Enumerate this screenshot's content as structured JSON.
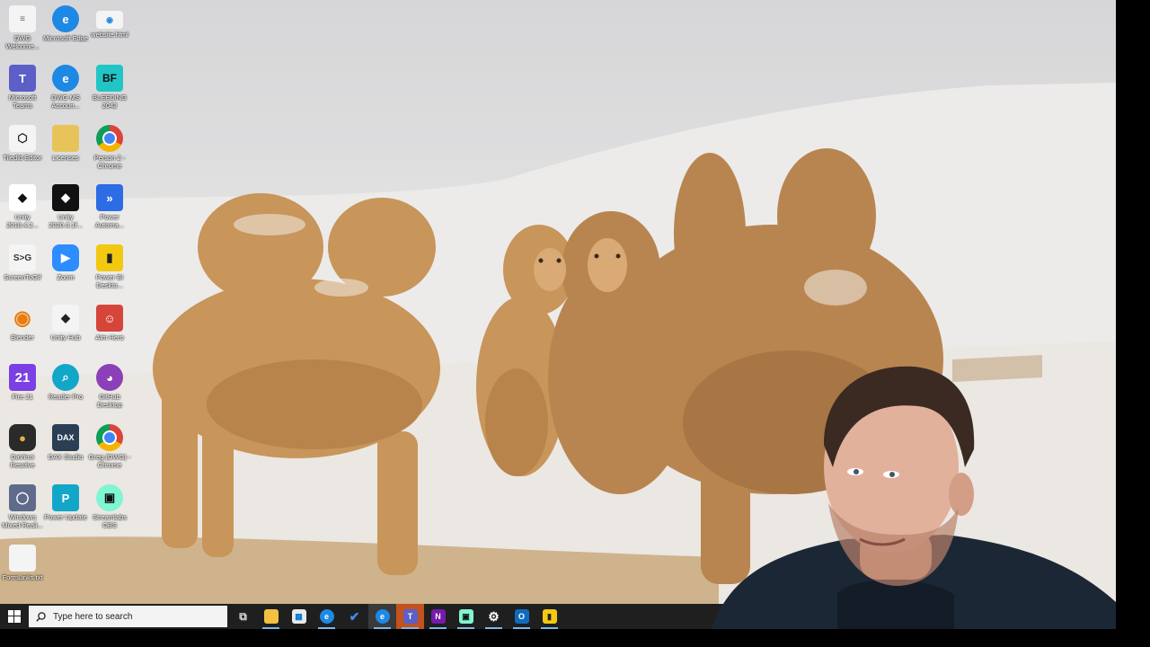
{
  "desktop": {
    "icons": [
      {
        "label": "DWG Welcome...",
        "icon": "document-icon",
        "color": "#f4f4f4"
      },
      {
        "label": "Microsoft Edge",
        "icon": "edge-icon",
        "color": "#1e88e5"
      },
      {
        "label": "website.html",
        "icon": "html-file-icon",
        "color": "#f4f4f4"
      },
      {
        "label": "Microsoft Teams",
        "icon": "teams-icon",
        "color": "#5b5fc7"
      },
      {
        "label": "DWG MS Accoun...",
        "icon": "edge-profile-icon",
        "color": "#1e88e5"
      },
      {
        "label": "BLEEDING 2042",
        "icon": "game-icon",
        "color": "#22c5c5"
      },
      {
        "label": "Tiledld Editor",
        "icon": "tiled-icon",
        "color": "#2b2b2b"
      },
      {
        "label": "Licenses",
        "icon": "folder-zip-icon",
        "color": "#e7c45a"
      },
      {
        "label": "Person 2 - Chrome",
        "icon": "chrome-icon",
        "color": "#db4437"
      },
      {
        "label": "Unity 2018.4.2...",
        "icon": "unity-icon",
        "color": "#111111"
      },
      {
        "label": "Unity 2020.3.1f...",
        "icon": "unity-dark-icon",
        "color": "#111111"
      },
      {
        "label": "Power Automa...",
        "icon": "power-automate-icon",
        "color": "#2d6ce5"
      },
      {
        "label": "ScreenToGif",
        "icon": "screentogif-icon",
        "color": "#f4f4f4"
      },
      {
        "label": "Zoom",
        "icon": "zoom-icon",
        "color": "#2d8cff"
      },
      {
        "label": "Power BI Deskto...",
        "icon": "power-bi-icon",
        "color": "#f2c811"
      },
      {
        "label": "Blender",
        "icon": "blender-icon",
        "color": "#e87d0d"
      },
      {
        "label": "Unity Hub",
        "icon": "unity-hub-icon",
        "color": "#f4f4f4"
      },
      {
        "label": "Aim Hero",
        "icon": "aim-hero-icon",
        "color": "#d6453a"
      },
      {
        "label": "Fire 21",
        "icon": "fire-21-icon",
        "color": "#7b3fe4"
      },
      {
        "label": "Reader Pro",
        "icon": "magnifier-icon",
        "color": "#12a7c9"
      },
      {
        "label": "GitHub Desktop",
        "icon": "github-icon",
        "color": "#8b3fb8"
      },
      {
        "label": "DaVinci Resolve",
        "icon": "davinci-icon",
        "color": "#2a2a2a"
      },
      {
        "label": "DAX Studio",
        "icon": "dax-studio-icon",
        "color": "#2a3f54"
      },
      {
        "label": "Greg (DWG) - Chrome",
        "icon": "chrome-profile-icon",
        "color": "#db4437"
      },
      {
        "label": "Windows Mixed Reali...",
        "icon": "mixed-reality-icon",
        "color": "#5f6b8a"
      },
      {
        "label": "Power Update",
        "icon": "power-update-icon",
        "color": "#12a7c9"
      },
      {
        "label": "Streamlabs OBS",
        "icon": "streamlabs-icon",
        "color": "#80f5d2"
      },
      {
        "label": "FormLinks.txt",
        "icon": "text-file-icon",
        "color": "#f4f4f4"
      }
    ]
  },
  "taskbar": {
    "search_placeholder": "Type here to search",
    "apps": [
      {
        "name": "task-view",
        "icon": "task-view-icon",
        "color": "#1f1f1f",
        "glyph": "⧉"
      },
      {
        "name": "file-explorer",
        "icon": "folder-icon",
        "color": "#f3c03f",
        "glyph": ""
      },
      {
        "name": "store",
        "icon": "store-icon",
        "color": "#e9e9e9",
        "glyph": ""
      },
      {
        "name": "edge",
        "icon": "edge-icon",
        "color": "#1e88e5",
        "glyph": ""
      },
      {
        "name": "todo",
        "icon": "checkmark-icon",
        "color": "#1f1f1f",
        "glyph": "✔"
      },
      {
        "name": "edge-profile",
        "icon": "edge-profile-icon",
        "color": "#1e88e5",
        "glyph": ""
      },
      {
        "name": "teams",
        "icon": "teams-icon",
        "color": "#5b5fc7",
        "glyph": "T"
      },
      {
        "name": "onenote",
        "icon": "onenote-icon",
        "color": "#7719aa",
        "glyph": "N"
      },
      {
        "name": "streamlabs",
        "icon": "streamlabs-icon",
        "color": "#80f5d2",
        "glyph": ""
      },
      {
        "name": "settings",
        "icon": "gear-icon",
        "color": "#1f1f1f",
        "glyph": "⚙"
      },
      {
        "name": "outlook",
        "icon": "outlook-icon",
        "color": "#0f6cbd",
        "glyph": "O"
      },
      {
        "name": "power-bi",
        "icon": "power-bi-icon",
        "color": "#f2c811",
        "glyph": ""
      }
    ]
  }
}
